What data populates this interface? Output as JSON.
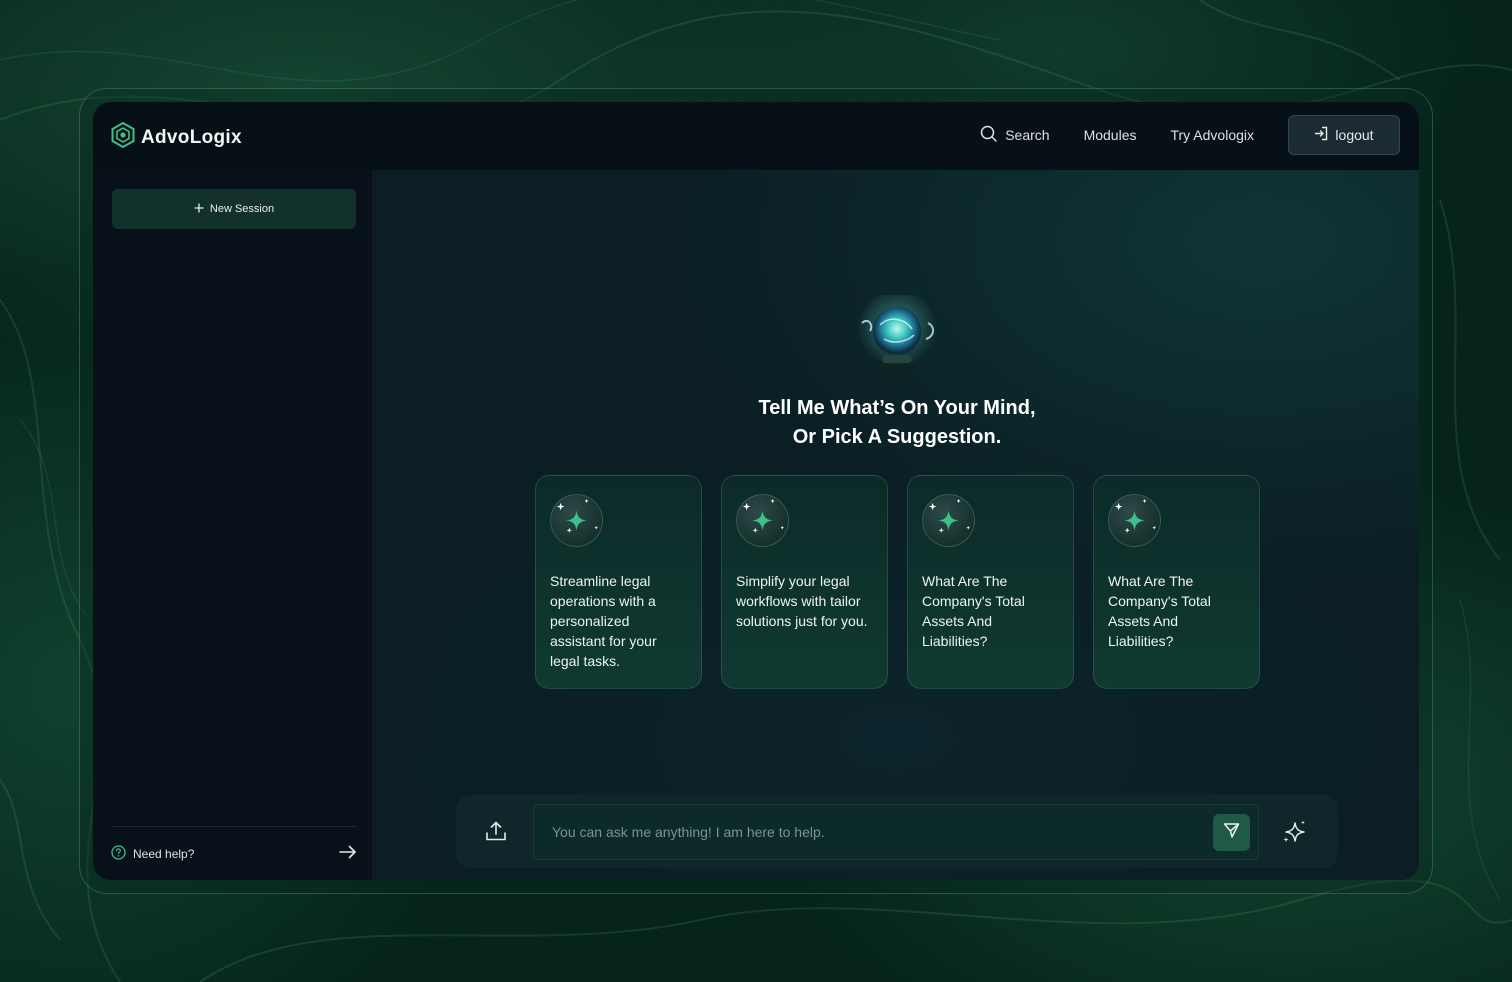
{
  "brand": {
    "name": "AdvoLogix"
  },
  "nav": {
    "search_label": "Search",
    "modules_label": "Modules",
    "try_label": "Try Advologix",
    "logout_label": "logout"
  },
  "sidebar": {
    "new_session_label": "New Session",
    "help_label": "Need help?"
  },
  "main": {
    "headline_line1": "Tell Me What’s On Your Mind,",
    "headline_line2": "Or Pick A Suggestion.",
    "suggestions": [
      {
        "text": "Streamline legal operations with a personalized assistant for your legal tasks."
      },
      {
        "text": "Simplify your legal workflows with tailor solutions just for you."
      },
      {
        "text": "What Are The Company's Total Assets And Liabilities?"
      },
      {
        "text": "What Are The Company's Total Assets And Liabilities?"
      }
    ]
  },
  "composer": {
    "placeholder": "You can ask me anything! I am here to help."
  },
  "icons": {
    "logo": "hexagon-logo-icon",
    "search": "search-icon",
    "logout": "login-arrow-icon",
    "new_session": "plus-icon",
    "help": "question-circle-icon",
    "help_arrow": "arrow-right-icon",
    "card": "sparkle-icon",
    "upload": "upload-icon",
    "send": "send-icon",
    "magic": "magic-sparkles-icon"
  },
  "colors": {
    "accent": "#1f5a47",
    "brand_green": "#3fbf8a",
    "background": "#06241a"
  }
}
